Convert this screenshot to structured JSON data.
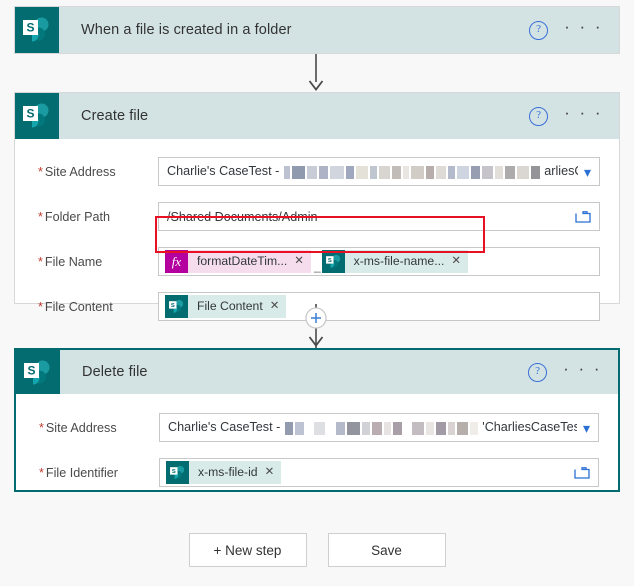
{
  "flow": {
    "trigger": {
      "icon": "sharepoint-icon",
      "title": "When a file is created in a folder",
      "help_label": "?",
      "menu_label": "· · ·"
    },
    "create_file": {
      "icon": "sharepoint-icon",
      "title": "Create file",
      "help_label": "?",
      "menu_label": "· · ·",
      "fields": {
        "site_address": {
          "label": "Site Address",
          "required": "*",
          "value_prefix": "Charlie's CaseTest - ",
          "value_suffix": "arliesCaseTest",
          "redacted": true,
          "control": "dropdown"
        },
        "folder_path": {
          "label": "Folder Path",
          "required": "*",
          "value": "/Shared Documents/Admin",
          "control": "folder-picker"
        },
        "file_name": {
          "label": "File Name",
          "required": "*",
          "highlighted": true,
          "tokens": [
            {
              "icon": "expression-fx-icon",
              "text": "formatDateTim...",
              "remove": "✕",
              "style": "pink"
            },
            {
              "icon": "sharepoint-icon",
              "text": "x-ms-file-name...",
              "remove": "✕",
              "style": "teal"
            }
          ],
          "separator": "_"
        },
        "file_content": {
          "label": "File Content",
          "required": "*",
          "tokens": [
            {
              "icon": "sharepoint-icon",
              "text": "File Content",
              "remove": "✕",
              "style": "teal"
            }
          ]
        }
      }
    },
    "delete_file": {
      "icon": "sharepoint-icon",
      "title": "Delete file",
      "selected": true,
      "help_label": "?",
      "menu_label": "· · ·",
      "fields": {
        "site_address": {
          "label": "Site Address",
          "required": "*",
          "value_prefix": "Charlie's CaseTest - ",
          "value_suffix": "'CharliesCaseTest",
          "redacted": true,
          "control": "dropdown"
        },
        "file_identifier": {
          "label": "File Identifier",
          "required": "*",
          "control": "folder-picker",
          "tokens": [
            {
              "icon": "sharepoint-icon",
              "text": "x-ms-file-id",
              "remove": "✕",
              "style": "teal"
            }
          ]
        }
      }
    },
    "insert_step_label": "+"
  },
  "footer": {
    "new_step_label": "+ New step",
    "save_label": "Save"
  },
  "colors": {
    "sharepoint_teal": "#036c70",
    "card_header": "#d3e3e4",
    "highlight_red": "#e81123",
    "expression_magenta": "#b4009e",
    "link_blue": "#2a6fd4"
  }
}
